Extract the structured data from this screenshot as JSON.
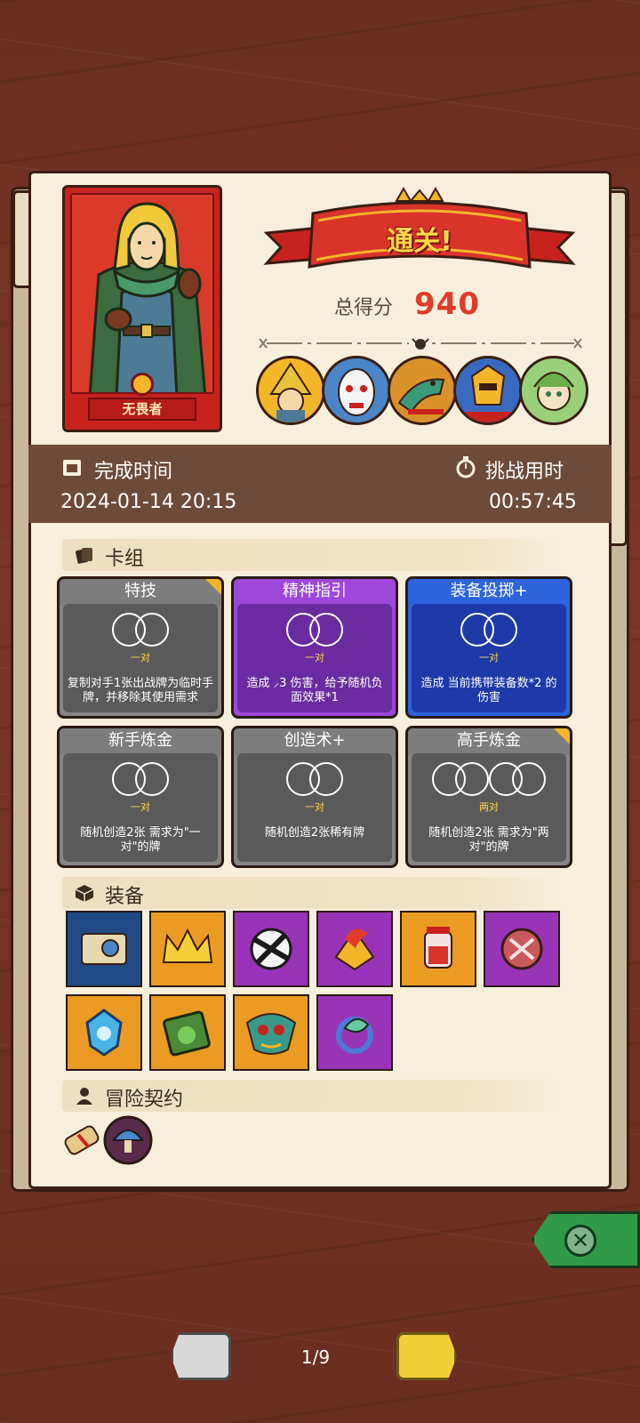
{
  "result": {
    "banner": "通关!",
    "score_label": "总得分",
    "score_value": "940"
  },
  "character": {
    "name": "无畏者"
  },
  "times": {
    "finish_label": "完成时间",
    "finish_value": "2024-01-14 20:15",
    "duration_label": "挑战用时",
    "duration_value": "00:57:45"
  },
  "sections": {
    "deck": "卡组",
    "equipment": "装备",
    "contract": "冒险契约"
  },
  "cards": [
    {
      "title": "特技",
      "pair": "一对",
      "desc": "复制对手1张出战牌为临时手牌，并移除其使用需求",
      "color": "gray"
    },
    {
      "title": "精神指引",
      "pair": "一对",
      "desc": "造成 ⸝3 伤害，给予随机负面效果*1",
      "color": "purple"
    },
    {
      "title": "装备投掷+",
      "pair": "一对",
      "desc": "造成 当前携带装备数*2 的伤害",
      "color": "blue"
    },
    {
      "title": "新手炼金",
      "pair": "一对",
      "desc": "随机创造2张 需求为\"一对\"的牌",
      "color": "gray"
    },
    {
      "title": "创造术+",
      "pair": "一对",
      "desc": "随机创造2张稀有牌",
      "color": "gray"
    },
    {
      "title": "高手炼金",
      "pair": "两对",
      "desc": "随机创造2张 需求为\"两对\"的牌",
      "color": "gray"
    }
  ],
  "equipment": [
    {
      "icon": "scroll-icon",
      "color": "#1f4a86"
    },
    {
      "icon": "crown-icon",
      "color": "#eb9a22"
    },
    {
      "icon": "broken-skull-icon",
      "color": "#9934b8"
    },
    {
      "icon": "fire-gem-icon",
      "color": "#9934b8"
    },
    {
      "icon": "potion-jar-icon",
      "color": "#eb9a22"
    },
    {
      "icon": "shield-emblem-icon",
      "color": "#9934b8"
    },
    {
      "icon": "blue-crystal-icon",
      "color": "#eb9a22"
    },
    {
      "icon": "green-book-icon",
      "color": "#eb9a22"
    },
    {
      "icon": "ornate-mask-icon",
      "color": "#eb9a22"
    },
    {
      "icon": "leaf-ring-icon",
      "color": "#9934b8"
    }
  ],
  "contracts": [
    {
      "icon": "scroll-contract-icon"
    },
    {
      "icon": "mushroom-badge-icon"
    }
  ],
  "pager": {
    "indicator": "1/9"
  }
}
